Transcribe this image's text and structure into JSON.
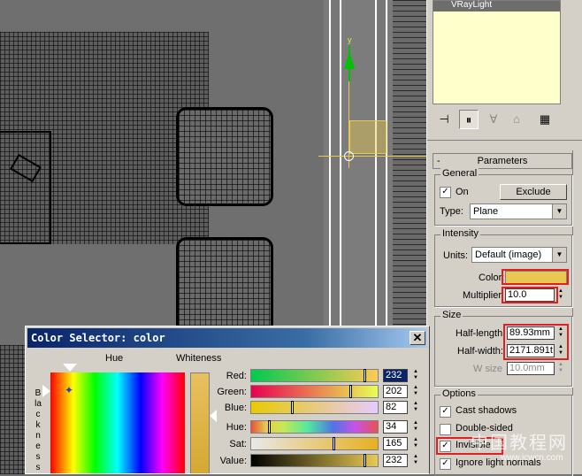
{
  "viewport": {
    "axis_label": "y"
  },
  "command_panel": {
    "object_name": "VRayLight",
    "rollout_title": "Parameters",
    "rollout_toggle": "-",
    "general": {
      "label": "General",
      "on_label": "On",
      "on_checked": true,
      "exclude_label": "Exclude",
      "type_label": "Type:",
      "type_value": "Plane"
    },
    "intensity": {
      "label": "Intensity",
      "units_label": "Units:",
      "units_value": "Default (image)",
      "color_label": "Color:",
      "color_swatch": "#e8c850",
      "multiplier_label": "Multiplier:",
      "multiplier_value": "10.0"
    },
    "size": {
      "label": "Size",
      "half_length_label": "Half-length:",
      "half_length_value": "89.93mm",
      "half_width_label": "Half-width:",
      "half_width_value": "2171.891t",
      "w_size_label": "W size",
      "w_size_value": "10.0mm"
    },
    "options": {
      "label": "Options",
      "items": [
        {
          "label": "Cast shadows",
          "checked": true
        },
        {
          "label": "Double-sided",
          "checked": false
        },
        {
          "label": "Invisible",
          "checked": true
        },
        {
          "label": "Ignore light normals",
          "checked": true
        }
      ]
    },
    "highlight_color": "#e02020"
  },
  "color_selector": {
    "title": "Color Selector: color",
    "close": "✕",
    "hue_header": "Hue",
    "whiteness_header": "Whiteness",
    "blackness_vertical": "Blackness",
    "channels": [
      {
        "label": "Red:",
        "value": "232",
        "selected": true
      },
      {
        "label": "Green:",
        "value": "202",
        "selected": false
      },
      {
        "label": "Blue:",
        "value": "82",
        "selected": false
      },
      {
        "label": "Hue:",
        "value": "34",
        "selected": false
      },
      {
        "label": "Sat:",
        "value": "165",
        "selected": false
      },
      {
        "label": "Value:",
        "value": "232",
        "selected": false
      }
    ]
  },
  "watermark": {
    "text": "中国教程网",
    "url": "www.jcwcn.com"
  }
}
